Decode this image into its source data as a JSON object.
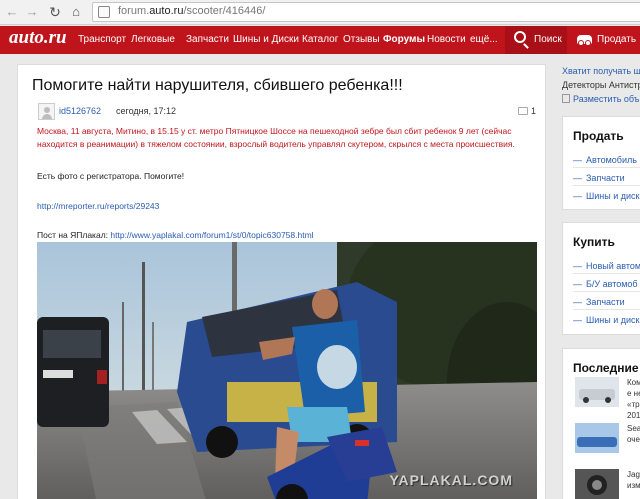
{
  "browser": {
    "url_prefix": "forum.",
    "url_domain": "auto.ru",
    "url_path": "/scooter/416446/"
  },
  "site": {
    "logo": "auto.ru",
    "nav": [
      "Транспорт",
      "Легковые",
      "Запчасти",
      "Шины и Диски",
      "Каталог",
      "Отзывы",
      "Форумы",
      "Новости",
      "ещё..."
    ],
    "search_label": "Поиск",
    "sell_label": "Продать"
  },
  "post": {
    "title": "Помогите найти нарушителя, сбившего ребенка!!!",
    "author": "id5126762",
    "date": "сегодня, 17:12",
    "comments": "1",
    "text_red": "Москва, 11 августа, Митино, в 15.15 у ст. метро Пятницкое Шоссе на пешеходной зебре был сбит ребенок 9 лет (сейчас находится в реанимации) в тяжелом состоянии, взрослый водитель управлял скутером, скрылся с места происшествия.",
    "text_plain": "Есть фото с регистратора. Помогите!",
    "link": "http://mreporter.ru/reports/29243",
    "source_label": "Пост на ЯПлакал:",
    "source_link": "http://www.yaplakal.com/forum1/st/0/topic630758.html",
    "watermark": "YAPLAKAL.COM"
  },
  "sidebar": {
    "promo_link": "Хватит получать шт",
    "promo_text": "Детекторы Антистр",
    "promo_post": "Разместить объ",
    "sell": {
      "heading": "Продать",
      "items": [
        "Автомобиль",
        "Запчасти",
        "Шины и диск"
      ]
    },
    "buy": {
      "heading": "Купить",
      "items": [
        "Новый автом",
        "Б/У автомоб",
        "Запчасти",
        "Шины и диск"
      ]
    },
    "latest": {
      "heading": "Последние",
      "items": [
        {
          "text": "Ком\nе не\n«тр\n2013"
        },
        {
          "text": "Sea\nоче"
        },
        {
          "text": "Jag\nизм"
        }
      ]
    }
  }
}
